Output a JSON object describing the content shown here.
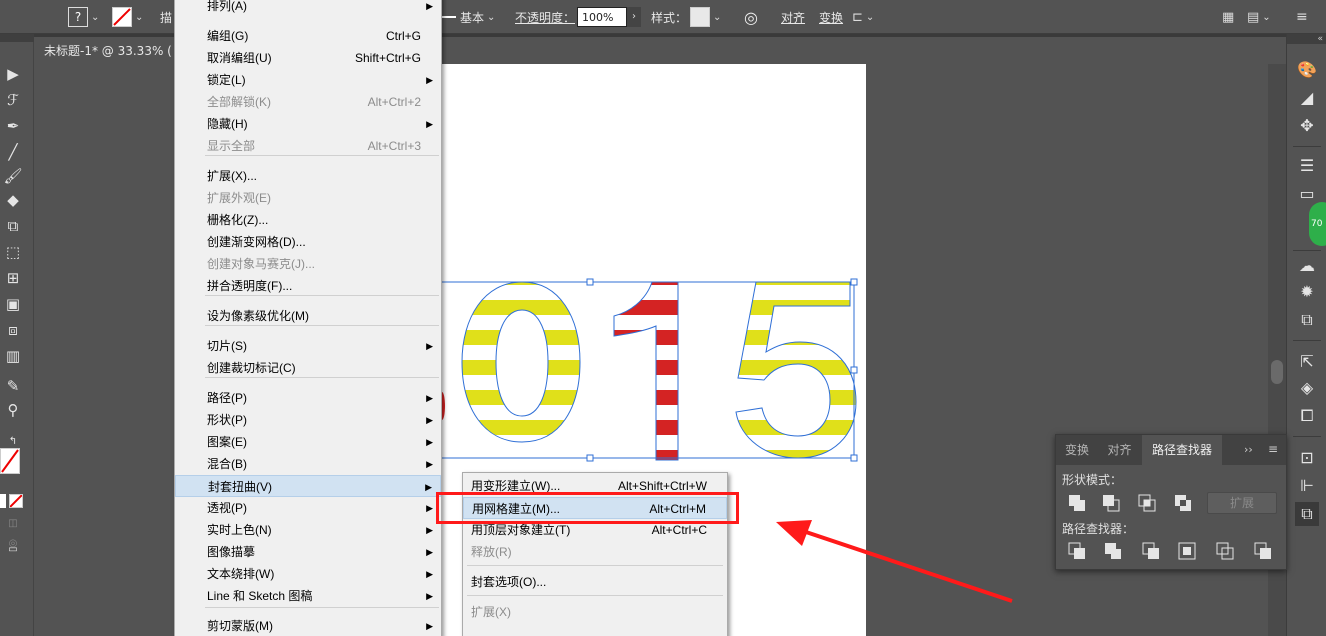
{
  "control_bar": {
    "stroke_label": "基本",
    "opacity_label": "不透明度：",
    "opacity_value": "100%",
    "style_label": "样式：",
    "align_label": "对齐",
    "transform_label": "变换"
  },
  "document_tab": {
    "title": "未标题-1* @ 33.33% ("
  },
  "main_menu": {
    "items": [
      {
        "label": "排列(A)",
        "shortcut": "",
        "submenu": true,
        "disabled": false
      },
      {
        "label": "编组(G)",
        "shortcut": "Ctrl+G",
        "submenu": false,
        "disabled": false
      },
      {
        "label": "取消编组(U)",
        "shortcut": "Shift+Ctrl+G",
        "submenu": false,
        "disabled": false
      },
      {
        "label": "锁定(L)",
        "shortcut": "",
        "submenu": true,
        "disabled": false
      },
      {
        "label": "全部解锁(K)",
        "shortcut": "Alt+Ctrl+2",
        "submenu": false,
        "disabled": true
      },
      {
        "label": "隐藏(H)",
        "shortcut": "",
        "submenu": true,
        "disabled": false
      },
      {
        "label": "显示全部",
        "shortcut": "Alt+Ctrl+3",
        "submenu": false,
        "disabled": true
      },
      {
        "label": "扩展(X)...",
        "shortcut": "",
        "submenu": false,
        "disabled": false
      },
      {
        "label": "扩展外观(E)",
        "shortcut": "",
        "submenu": false,
        "disabled": true
      },
      {
        "label": "栅格化(Z)...",
        "shortcut": "",
        "submenu": false,
        "disabled": false
      },
      {
        "label": "创建渐变网格(D)...",
        "shortcut": "",
        "submenu": false,
        "disabled": false
      },
      {
        "label": "创建对象马赛克(J)...",
        "shortcut": "",
        "submenu": false,
        "disabled": true
      },
      {
        "label": "拼合透明度(F)...",
        "shortcut": "",
        "submenu": false,
        "disabled": false
      },
      {
        "label": "设为像素级优化(M)",
        "shortcut": "",
        "submenu": false,
        "disabled": false
      },
      {
        "label": "切片(S)",
        "shortcut": "",
        "submenu": true,
        "disabled": false
      },
      {
        "label": "创建裁切标记(C)",
        "shortcut": "",
        "submenu": false,
        "disabled": false
      },
      {
        "label": "路径(P)",
        "shortcut": "",
        "submenu": true,
        "disabled": false
      },
      {
        "label": "形状(P)",
        "shortcut": "",
        "submenu": true,
        "disabled": false
      },
      {
        "label": "图案(E)",
        "shortcut": "",
        "submenu": true,
        "disabled": false
      },
      {
        "label": "混合(B)",
        "shortcut": "",
        "submenu": true,
        "disabled": false
      },
      {
        "label": "封套扭曲(V)",
        "shortcut": "",
        "submenu": true,
        "disabled": false
      },
      {
        "label": "透视(P)",
        "shortcut": "",
        "submenu": true,
        "disabled": false
      },
      {
        "label": "实时上色(N)",
        "shortcut": "",
        "submenu": true,
        "disabled": false
      },
      {
        "label": "图像描摹",
        "shortcut": "",
        "submenu": true,
        "disabled": false
      },
      {
        "label": "文本绕排(W)",
        "shortcut": "",
        "submenu": true,
        "disabled": false
      },
      {
        "label": "Line 和 Sketch 图稿",
        "shortcut": "",
        "submenu": true,
        "disabled": false
      },
      {
        "label": "剪切蒙版(M)",
        "shortcut": "",
        "submenu": true,
        "disabled": false
      }
    ]
  },
  "envelope_submenu": {
    "items": [
      {
        "label": "用变形建立(W)...",
        "shortcut": "Alt+Shift+Ctrl+W",
        "disabled": false
      },
      {
        "label": "用网格建立(M)...",
        "shortcut": "Alt+Ctrl+M",
        "disabled": false
      },
      {
        "label": "用顶层对象建立(T)",
        "shortcut": "Alt+Ctrl+C",
        "disabled": false
      },
      {
        "label": "释放(R)",
        "shortcut": "",
        "disabled": true
      },
      {
        "label": "封套选项(O)...",
        "shortcut": "",
        "disabled": false
      },
      {
        "label": "扩展(X)",
        "shortcut": "",
        "disabled": true
      }
    ]
  },
  "pathfinder_panel": {
    "tabs": [
      "变换",
      "对齐",
      "路径查找器"
    ],
    "shape_modes_label": "形状模式：",
    "pathfinders_label": "路径查找器：",
    "expand_label": "扩展"
  },
  "artwork": {
    "digits": [
      "0",
      "1",
      "5"
    ]
  },
  "colors": {
    "highlight": "#ff1a1a",
    "stripe_yellow": "#e0e01a",
    "stripe_red": "#d42323",
    "selection_blue": "#2f6fd6"
  }
}
